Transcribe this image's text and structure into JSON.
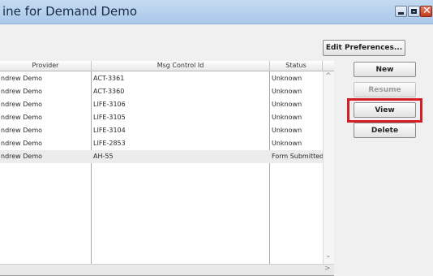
{
  "window": {
    "title": "ine for Demand Demo"
  },
  "toolbar": {
    "edit_preferences_label": "Edit Preferences..."
  },
  "actions": {
    "new_label": "New",
    "resume_label": "Resume",
    "view_label": "View",
    "delete_label": "Delete"
  },
  "grid": {
    "columns": [
      "Provider",
      "Msg Control Id",
      "Status"
    ],
    "rows": [
      {
        "provider": "ndrew Demo",
        "msg_control_id": "ACT-3361",
        "status": "Unknown"
      },
      {
        "provider": "ndrew Demo",
        "msg_control_id": "ACT-3360",
        "status": "Unknown"
      },
      {
        "provider": "ndrew Demo",
        "msg_control_id": "LIFE-3106",
        "status": "Unknown"
      },
      {
        "provider": "ndrew Demo",
        "msg_control_id": "LIFE-3105",
        "status": "Unknown"
      },
      {
        "provider": "ndrew Demo",
        "msg_control_id": "LIFE-3104",
        "status": "Unknown"
      },
      {
        "provider": "ndrew Demo",
        "msg_control_id": "LIFE-2853",
        "status": "Unknown"
      },
      {
        "provider": "ndrew Demo",
        "msg_control_id": "AH-55",
        "status": "Form Submitted"
      }
    ],
    "selected_row_index": 6
  },
  "icons": {
    "minimize": "minimize-icon",
    "maximize": "maximize-icon",
    "close": "close-icon",
    "scroll_up": "chevron-up-icon",
    "scroll_down": "chevron-down-icon",
    "scroll_right": "chevron-right-icon"
  },
  "colors": {
    "highlight": "#d41f26",
    "titlebar": "#b6cfee",
    "close_button": "#c4391c"
  }
}
